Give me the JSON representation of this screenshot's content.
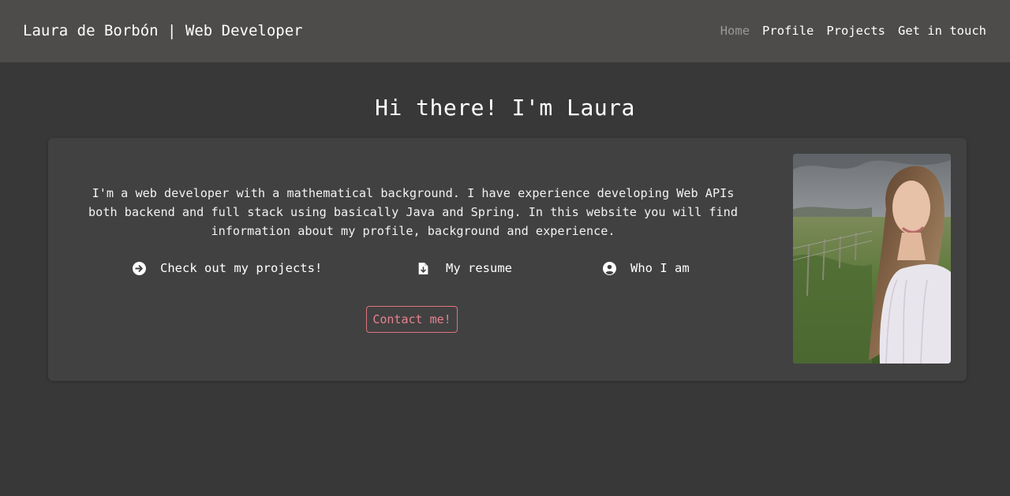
{
  "nav": {
    "brand": "Laura de Borbón | Web Developer",
    "links": [
      {
        "label": "Home",
        "active": true
      },
      {
        "label": "Profile",
        "active": false
      },
      {
        "label": "Projects",
        "active": false
      },
      {
        "label": "Get in touch",
        "active": false
      }
    ]
  },
  "main": {
    "heading": "Hi there! I'm Laura",
    "intro": "I'm a web developer with a mathematical background. I have experience developing Web APIs both backend and full stack using basically Java and Spring. In this website you will find information about my profile, background and experience.",
    "actions": [
      {
        "label": "Check out my projects!",
        "icon": "arrow-circle-right-icon"
      },
      {
        "label": "My resume",
        "icon": "file-download-icon"
      },
      {
        "label": "Who I am",
        "icon": "user-circle-icon"
      }
    ],
    "contact_label": "Contact me!",
    "photo": {
      "icon": "profile-photo"
    }
  },
  "colors": {
    "navbar_bg": "#4d4c4a",
    "page_bg": "#383838",
    "card_bg": "#414141",
    "accent": "#e8828d",
    "nav_active": "#9a9a9a"
  }
}
